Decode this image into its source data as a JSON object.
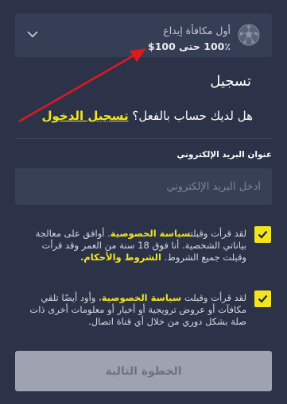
{
  "bonus": {
    "line1": "أول مكافأة إيداع",
    "line2": "100٪ حتى 100$",
    "icon": "soccer-ball-icon"
  },
  "form": {
    "title": "تسجيل",
    "have_account": "هل لديك حساب بالفعل؟",
    "login_link": "تسجيل الدخول",
    "email_label": "عنوان البريد الإلكتروني",
    "email_placeholder": "أدخل البريد الإلكتروني",
    "email_value": ""
  },
  "consent1": {
    "checked": true,
    "text_a": "لقد قرأت وقبلت",
    "privacy_link": "سياسة الخصوصية",
    "text_b": ". أوافق على معالجة بياناتي الشخصية. أنا فوق 18 سنة من العمر وقد قرأت وقبلت جميع الشروط.",
    "terms_link": "الشروط والأحكام."
  },
  "consent2": {
    "checked": true,
    "text_a": "لقد قرأت وقبلت",
    "privacy_link": "سياسة الخصوصية",
    "text_b": "، وأود أيضًا تلقي مكافآت أو عروض ترويجية أو أخبار أو معلومات أخرى ذات صلة بشكل دوري من خلال أي قناة اتصال."
  },
  "next_button": "الخطوة التالية",
  "colors": {
    "background": "#2c3348",
    "panel": "#363e55",
    "accent": "#f2e51f",
    "button": "#9fa3b1",
    "annotation_arrow": "#e0191f"
  }
}
